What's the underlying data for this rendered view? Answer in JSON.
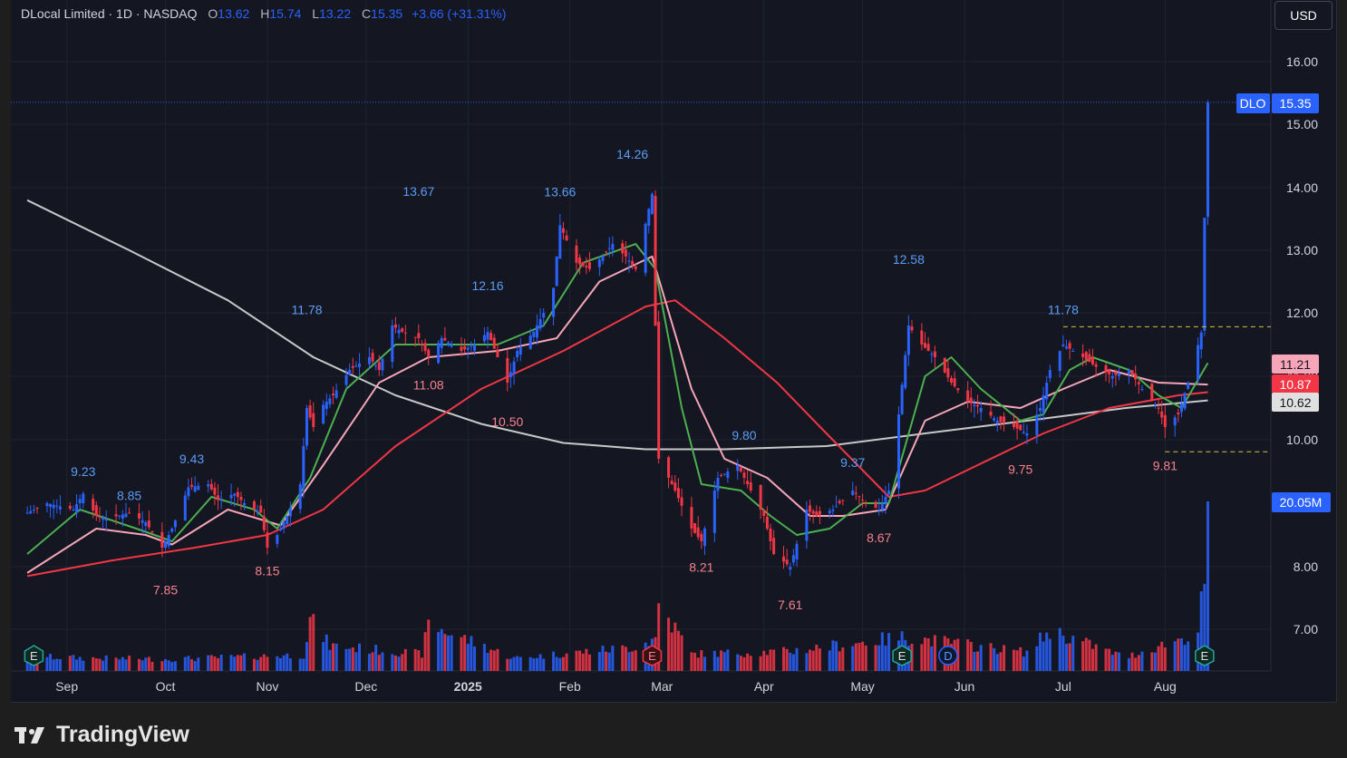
{
  "header": {
    "symbol": "DLocal Limited · 1D · NASDAQ",
    "o_label": "O",
    "o": "13.62",
    "h_label": "H",
    "h": "15.74",
    "l_label": "L",
    "l": "13.22",
    "c_label": "C",
    "c": "15.35",
    "change": "+3.66 (+31.31%)"
  },
  "currency_button": "USD",
  "brand": "TradingView",
  "colors": {
    "up": "#2962ff",
    "down": "#f23645",
    "background": "#141722",
    "ma_fast": "#4caf50",
    "ma_pink": "#f7a5b8",
    "ma_mid": "#f23645",
    "ma_slow": "#c8c8c8"
  },
  "chart_data": {
    "type": "candlestick",
    "ticker": "DLO",
    "price_axis": {
      "ticks": [
        "7.00",
        "8.00",
        "10.00",
        "11.00",
        "12.00",
        "13.00",
        "14.00",
        "15.00",
        "16.00"
      ]
    },
    "time_axis": [
      "Sep",
      "Oct",
      "Nov",
      "Dec",
      "2025",
      "Feb",
      "Mar",
      "Apr",
      "May",
      "Jun",
      "Jul",
      "Aug"
    ],
    "last_price": "15.35",
    "ma_values": [
      "11.21",
      "10.87",
      "10.62"
    ],
    "volume_label": "20.05M",
    "high_low_labels": [
      {
        "text": "9.23",
        "kind": "high",
        "date": "2024-09-06",
        "value": 9.23
      },
      {
        "text": "8.85",
        "kind": "high",
        "date": "2024-09-20",
        "value": 8.85
      },
      {
        "text": "7.85",
        "kind": "low",
        "date": "2024-10-01",
        "value": 7.85
      },
      {
        "text": "9.43",
        "kind": "high",
        "date": "2024-10-09",
        "value": 9.43
      },
      {
        "text": "8.15",
        "kind": "low",
        "date": "2024-11-01",
        "value": 8.15
      },
      {
        "text": "11.78",
        "kind": "high",
        "date": "2024-11-13",
        "value": 11.78
      },
      {
        "text": "13.67",
        "kind": "high",
        "date": "2024-12-17",
        "value": 13.67
      },
      {
        "text": "11.08",
        "kind": "low",
        "date": "2024-12-20",
        "value": 11.08
      },
      {
        "text": "12.16",
        "kind": "high",
        "date": "2025-01-07",
        "value": 12.16
      },
      {
        "text": "10.50",
        "kind": "low",
        "date": "2025-01-13",
        "value": 10.5
      },
      {
        "text": "13.66",
        "kind": "high",
        "date": "2025-01-29",
        "value": 13.66
      },
      {
        "text": "14.26",
        "kind": "high",
        "date": "2025-02-20",
        "value": 14.26
      },
      {
        "text": "8.21",
        "kind": "low",
        "date": "2025-03-13",
        "value": 8.21
      },
      {
        "text": "9.80",
        "kind": "high",
        "date": "2025-03-26",
        "value": 9.8
      },
      {
        "text": "7.61",
        "kind": "low",
        "date": "2025-04-09",
        "value": 7.61
      },
      {
        "text": "9.37",
        "kind": "high",
        "date": "2025-04-28",
        "value": 9.37
      },
      {
        "text": "8.67",
        "kind": "low",
        "date": "2025-05-06",
        "value": 8.67
      },
      {
        "text": "12.58",
        "kind": "high",
        "date": "2025-05-15",
        "value": 12.58
      },
      {
        "text": "9.75",
        "kind": "low",
        "date": "2025-06-18",
        "value": 9.75
      },
      {
        "text": "11.78",
        "kind": "high",
        "date": "2025-07-01",
        "value": 11.78
      },
      {
        "text": "9.81",
        "kind": "low",
        "date": "2025-08-01",
        "value": 9.81
      }
    ],
    "price_path": [
      [
        "2024-08-20",
        8.85
      ],
      [
        "2024-08-26",
        9.0
      ],
      [
        "2024-09-03",
        8.9
      ],
      [
        "2024-09-06",
        9.15
      ],
      [
        "2024-09-10",
        8.8
      ],
      [
        "2024-09-13",
        8.75
      ],
      [
        "2024-09-20",
        8.85
      ],
      [
        "2024-09-25",
        8.7
      ],
      [
        "2024-09-30",
        8.3
      ],
      [
        "2024-10-03",
        8.6
      ],
      [
        "2024-10-08",
        9.25
      ],
      [
        "2024-10-14",
        9.3
      ],
      [
        "2024-10-17",
        9.05
      ],
      [
        "2024-10-22",
        9.15
      ],
      [
        "2024-10-25",
        9.0
      ],
      [
        "2024-10-30",
        8.85
      ],
      [
        "2024-11-01",
        8.3
      ],
      [
        "2024-11-04",
        8.5
      ],
      [
        "2024-11-07",
        8.8
      ],
      [
        "2024-11-11",
        9.3
      ],
      [
        "2024-11-13",
        10.5
      ],
      [
        "2024-11-15",
        10.2
      ],
      [
        "2024-11-18",
        10.55
      ],
      [
        "2024-11-21",
        10.7
      ],
      [
        "2024-11-26",
        11.1
      ],
      [
        "2024-12-02",
        11.3
      ],
      [
        "2024-12-05",
        11.1
      ],
      [
        "2024-12-09",
        11.8
      ],
      [
        "2024-12-12",
        11.7
      ],
      [
        "2024-12-17",
        11.6
      ],
      [
        "2024-12-20",
        11.3
      ],
      [
        "2024-12-24",
        11.6
      ],
      [
        "2024-12-30",
        11.4
      ],
      [
        "2025-01-03",
        11.5
      ],
      [
        "2025-01-07",
        11.7
      ],
      [
        "2025-01-13",
        10.9
      ],
      [
        "2025-01-16",
        11.4
      ],
      [
        "2025-01-21",
        11.7
      ],
      [
        "2025-01-24",
        12.0
      ],
      [
        "2025-01-27",
        12.4
      ],
      [
        "2025-01-29",
        13.4
      ],
      [
        "2025-02-03",
        12.8
      ],
      [
        "2025-02-07",
        12.7
      ],
      [
        "2025-02-11",
        12.9
      ],
      [
        "2025-02-14",
        13.1
      ],
      [
        "2025-02-18",
        12.9
      ],
      [
        "2025-02-21",
        12.7
      ],
      [
        "2025-02-26",
        13.9
      ],
      [
        "2025-02-28",
        9.7
      ],
      [
        "2025-03-05",
        9.2
      ],
      [
        "2025-03-10",
        8.6
      ],
      [
        "2025-03-13",
        8.4
      ],
      [
        "2025-03-18",
        9.4
      ],
      [
        "2025-03-24",
        9.6
      ],
      [
        "2025-03-27",
        9.3
      ],
      [
        "2025-04-01",
        8.8
      ],
      [
        "2025-04-04",
        8.2
      ],
      [
        "2025-04-09",
        8.0
      ],
      [
        "2025-04-14",
        8.9
      ],
      [
        "2025-04-17",
        8.8
      ],
      [
        "2025-04-22",
        8.9
      ],
      [
        "2025-04-28",
        9.2
      ],
      [
        "2025-05-02",
        9.0
      ],
      [
        "2025-05-06",
        8.9
      ],
      [
        "2025-05-09",
        9.2
      ],
      [
        "2025-05-12",
        10.4
      ],
      [
        "2025-05-15",
        11.8
      ],
      [
        "2025-05-19",
        11.5
      ],
      [
        "2025-05-23",
        11.3
      ],
      [
        "2025-05-28",
        10.9
      ],
      [
        "2025-06-02",
        10.6
      ],
      [
        "2025-06-06",
        10.5
      ],
      [
        "2025-06-11",
        10.3
      ],
      [
        "2025-06-16",
        10.2
      ],
      [
        "2025-06-20",
        10.1
      ],
      [
        "2025-06-24",
        10.5
      ],
      [
        "2025-06-27",
        11.1
      ],
      [
        "2025-07-01",
        11.5
      ],
      [
        "2025-07-07",
        11.3
      ],
      [
        "2025-07-11",
        11.15
      ],
      [
        "2025-07-16",
        11.0
      ],
      [
        "2025-07-21",
        11.1
      ],
      [
        "2025-07-25",
        10.8
      ],
      [
        "2025-07-30",
        10.5
      ],
      [
        "2025-08-01",
        10.2
      ],
      [
        "2025-08-05",
        10.4
      ],
      [
        "2025-08-08",
        10.9
      ],
      [
        "2025-08-12",
        11.69
      ],
      [
        "2025-08-14",
        15.35
      ]
    ],
    "ma_fast": [
      [
        "2024-08-20",
        8.2
      ],
      [
        "2024-09-05",
        8.9
      ],
      [
        "2024-09-25",
        8.55
      ],
      [
        "2024-10-03",
        8.4
      ],
      [
        "2024-10-15",
        9.1
      ],
      [
        "2024-10-28",
        8.9
      ],
      [
        "2024-11-04",
        8.6
      ],
      [
        "2024-11-14",
        9.4
      ],
      [
        "2024-11-25",
        10.8
      ],
      [
        "2024-12-10",
        11.5
      ],
      [
        "2024-12-24",
        11.5
      ],
      [
        "2025-01-10",
        11.5
      ],
      [
        "2025-01-24",
        11.8
      ],
      [
        "2025-02-05",
        12.8
      ],
      [
        "2025-02-21",
        13.1
      ],
      [
        "2025-02-27",
        12.7
      ],
      [
        "2025-03-07",
        10.5
      ],
      [
        "2025-03-13",
        9.3
      ],
      [
        "2025-03-25",
        9.2
      ],
      [
        "2025-04-03",
        8.8
      ],
      [
        "2025-04-11",
        8.5
      ],
      [
        "2025-04-21",
        8.6
      ],
      [
        "2025-05-01",
        9.0
      ],
      [
        "2025-05-09",
        9.0
      ],
      [
        "2025-05-20",
        11.0
      ],
      [
        "2025-05-28",
        11.3
      ],
      [
        "2025-06-06",
        10.8
      ],
      [
        "2025-06-18",
        10.3
      ],
      [
        "2025-06-25",
        10.4
      ],
      [
        "2025-07-03",
        11.1
      ],
      [
        "2025-07-10",
        11.3
      ],
      [
        "2025-07-21",
        11.1
      ],
      [
        "2025-07-30",
        10.7
      ],
      [
        "2025-08-06",
        10.5
      ],
      [
        "2025-08-14",
        11.21
      ]
    ],
    "ma_pink": [
      [
        "2024-08-20",
        7.9
      ],
      [
        "2024-09-10",
        8.6
      ],
      [
        "2024-09-25",
        8.5
      ],
      [
        "2024-10-03",
        8.35
      ],
      [
        "2024-10-20",
        8.9
      ],
      [
        "2024-11-05",
        8.65
      ],
      [
        "2024-11-18",
        9.6
      ],
      [
        "2024-12-05",
        10.9
      ],
      [
        "2024-12-20",
        11.3
      ],
      [
        "2025-01-10",
        11.4
      ],
      [
        "2025-01-28",
        11.6
      ],
      [
        "2025-02-10",
        12.5
      ],
      [
        "2025-02-26",
        12.9
      ],
      [
        "2025-03-10",
        10.8
      ],
      [
        "2025-03-20",
        9.7
      ],
      [
        "2025-04-02",
        9.4
      ],
      [
        "2025-04-15",
        8.8
      ],
      [
        "2025-04-25",
        8.8
      ],
      [
        "2025-05-08",
        8.9
      ],
      [
        "2025-05-20",
        10.3
      ],
      [
        "2025-06-02",
        10.6
      ],
      [
        "2025-06-18",
        10.5
      ],
      [
        "2025-07-01",
        10.8
      ],
      [
        "2025-07-15",
        11.1
      ],
      [
        "2025-07-30",
        10.9
      ],
      [
        "2025-08-14",
        10.87
      ]
    ],
    "ma_mid": [
      [
        "2024-08-20",
        7.85
      ],
      [
        "2024-09-15",
        8.1
      ],
      [
        "2024-10-10",
        8.3
      ],
      [
        "2024-11-01",
        8.5
      ],
      [
        "2024-11-18",
        8.9
      ],
      [
        "2024-12-10",
        9.9
      ],
      [
        "2025-01-05",
        10.8
      ],
      [
        "2025-01-30",
        11.4
      ],
      [
        "2025-02-24",
        12.1
      ],
      [
        "2025-03-05",
        12.2
      ],
      [
        "2025-03-20",
        11.6
      ],
      [
        "2025-04-05",
        10.9
      ],
      [
        "2025-04-20",
        10.1
      ],
      [
        "2025-05-09",
        9.1
      ],
      [
        "2025-05-20",
        9.2
      ],
      [
        "2025-06-05",
        9.6
      ],
      [
        "2025-06-25",
        10.1
      ],
      [
        "2025-07-15",
        10.5
      ],
      [
        "2025-08-05",
        10.7
      ],
      [
        "2025-08-14",
        10.75
      ]
    ],
    "ma_slow": [
      [
        "2024-08-20",
        13.8
      ],
      [
        "2024-09-20",
        13.0
      ],
      [
        "2024-10-20",
        12.2
      ],
      [
        "2024-11-15",
        11.3
      ],
      [
        "2024-12-10",
        10.7
      ],
      [
        "2025-01-05",
        10.25
      ],
      [
        "2025-01-30",
        9.95
      ],
      [
        "2025-02-24",
        9.85
      ],
      [
        "2025-03-20",
        9.85
      ],
      [
        "2025-04-20",
        9.9
      ],
      [
        "2025-05-20",
        10.1
      ],
      [
        "2025-06-20",
        10.3
      ],
      [
        "2025-07-20",
        10.5
      ],
      [
        "2025-08-14",
        10.62
      ]
    ],
    "events": [
      {
        "date": "2024-08-22",
        "label": "E",
        "kind": "earnings"
      },
      {
        "date": "2025-02-26",
        "label": "E",
        "kind": "earnings-red"
      },
      {
        "date": "2025-05-13",
        "label": "E",
        "kind": "earnings"
      },
      {
        "date": "2025-05-27",
        "label": "D",
        "kind": "dividend"
      },
      {
        "date": "2025-08-13",
        "label": "E",
        "kind": "earnings"
      }
    ],
    "volume_path": [
      [
        "2024-08-20",
        1.7
      ],
      [
        "2024-09-10",
        1.5
      ],
      [
        "2024-10-02",
        1.4
      ],
      [
        "2024-11-12",
        1.9
      ],
      [
        "2024-11-14",
        6.0
      ],
      [
        "2024-11-20",
        3.0
      ],
      [
        "2024-12-18",
        2.0
      ],
      [
        "2024-12-20",
        5.5
      ],
      [
        "2025-01-15",
        1.5
      ],
      [
        "2025-02-20",
        2.8
      ],
      [
        "2025-02-27",
        3.8
      ],
      [
        "2025-02-28",
        8.0
      ],
      [
        "2025-03-10",
        2.0
      ],
      [
        "2025-04-08",
        2.3
      ],
      [
        "2025-05-14",
        4.0
      ],
      [
        "2025-06-20",
        2.2
      ],
      [
        "2025-06-27",
        4.8
      ],
      [
        "2025-07-20",
        1.6
      ],
      [
        "2025-08-11",
        4.5
      ],
      [
        "2025-08-13",
        11.0
      ],
      [
        "2025-08-14",
        20.05
      ]
    ]
  }
}
